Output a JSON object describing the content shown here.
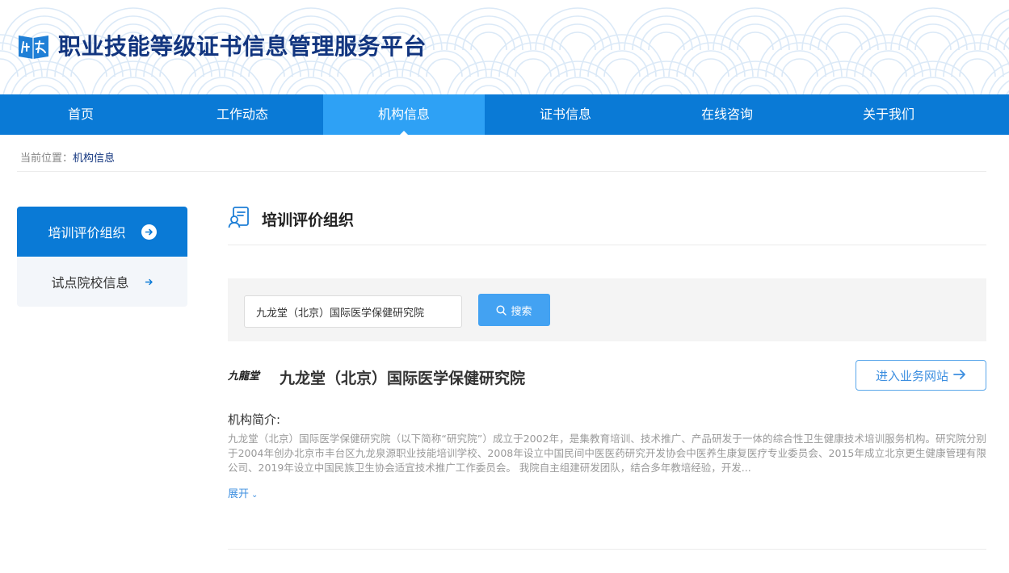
{
  "header": {
    "site_title": "职业技能等级证书信息管理服务平台",
    "logo_icon": "brand-logo-icon"
  },
  "nav": {
    "items": [
      {
        "label": "首页",
        "active": false
      },
      {
        "label": "工作动态",
        "active": false
      },
      {
        "label": "机构信息",
        "active": true
      },
      {
        "label": "证书信息",
        "active": false
      },
      {
        "label": "在线咨询",
        "active": false
      },
      {
        "label": "关于我们",
        "active": false
      }
    ]
  },
  "breadcrumb": {
    "prefix": "当前位置：",
    "current": "机构信息"
  },
  "sidebar": {
    "items": [
      {
        "label": "培训评价组织",
        "active": true
      },
      {
        "label": "试点院校信息",
        "active": false
      }
    ]
  },
  "section": {
    "title": "培训评价组织"
  },
  "search": {
    "value": "九龙堂（北京）国际医学保健研究院",
    "button_label": "搜索"
  },
  "org": {
    "name": "九龙堂（北京）国际医学保健研究院",
    "logo_text": "九龍堂",
    "enter_label": "进入业务网站",
    "intro_label": "机构简介:",
    "intro_text": "九龙堂（北京）国际医学保健研究院（以下简称“研究院”）成立于2002年，是集教育培训、技术推广、产品研发于一体的综合性卫生健康技术培训服务机构。研究院分别于2004年创办北京市丰台区九龙泉源职业技能培训学校、2008年设立中国民间中医医药研究开发协会中医养生康复医疗专业委员会、2015年成立北京更生健康管理有限公司、2019年设立中国民族卫生协会适宜技术推广工作委员会。 我院自主组建研发团队，结合多年教培经验，开发...",
    "expand_label": "展开"
  },
  "colors": {
    "nav_bg": "#0a7ad6",
    "nav_active": "#2ea1f5",
    "title_blue": "#12357f",
    "button_blue": "#43a2f2"
  }
}
